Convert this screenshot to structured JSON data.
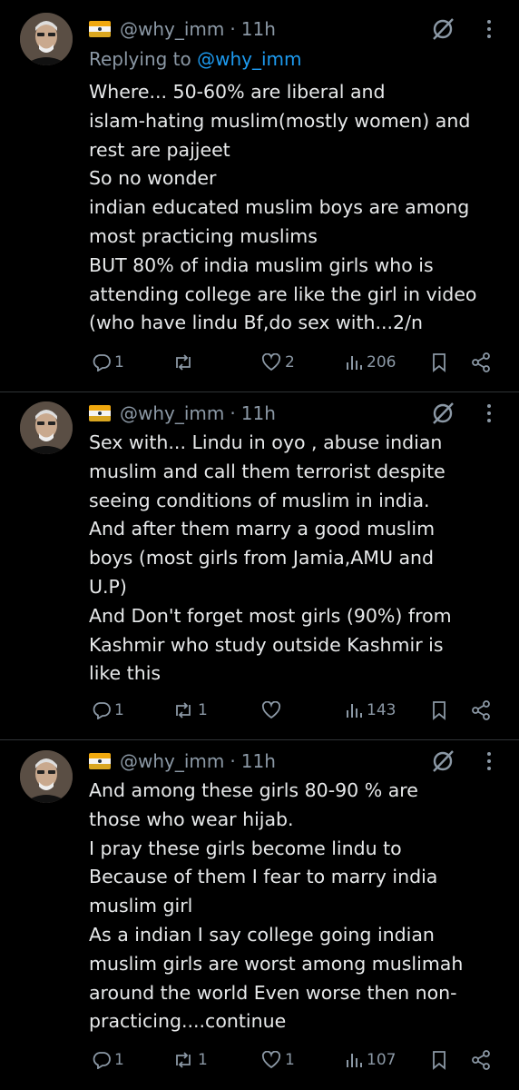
{
  "tweets": [
    {
      "handle": "@why_imm",
      "time": "11h",
      "replying_prefix": "Replying to ",
      "replying_handle": "@why_imm",
      "lines": [
        "Where... 50-60% are liberal and",
        "islam-hating muslim(mostly women) and",
        "rest are pajjeet",
        "So no wonder",
        "indian educated muslim boys are among",
        "most practicing muslims",
        "BUT 80% of india muslim girls who is",
        "attending college are like the girl in video",
        "(who have lindu Bf,do sex with...2/n"
      ],
      "replies": "1",
      "reposts": "",
      "likes": "2",
      "views": "206"
    },
    {
      "handle": "@why_imm",
      "time": "11h",
      "lines": [
        "Sex with... Lindu in oyo , abuse indian",
        "muslim and call them terrorist despite",
        "seeing conditions of muslim in india.",
        "And after them marry a good muslim",
        "boys (most girls from Jamia,AMU and",
        "U.P)",
        "And Don't forget most girls (90%)  from",
        "Kashmir who study outside Kashmir is",
        "like this"
      ],
      "replies": "1",
      "reposts": "1",
      "likes": "",
      "views": "143"
    },
    {
      "handle": "@why_imm",
      "time": "11h",
      "lines": [
        "And among these girls 80-90 % are",
        "those who wear hijab.",
        "I pray these girls become lindu to",
        "Because of them I fear to marry india",
        "muslim girl",
        "As a indian I say college going indian",
        "muslim girls are worst among muslimah",
        "around the world Even worse then non-",
        "practicing....continue"
      ],
      "replies": "1",
      "reposts": "1",
      "likes": "1",
      "views": "107"
    }
  ],
  "colors": {
    "background": "#000000",
    "text": "#e7e9ea",
    "muted": "#8b98a5",
    "link": "#1d9bf0",
    "divider": "#2f3336"
  },
  "icons": [
    "flag-emoji-icon",
    "grok-icon",
    "more-icon",
    "reply-icon",
    "repost-icon",
    "like-icon",
    "views-icon",
    "bookmark-icon",
    "share-icon"
  ]
}
